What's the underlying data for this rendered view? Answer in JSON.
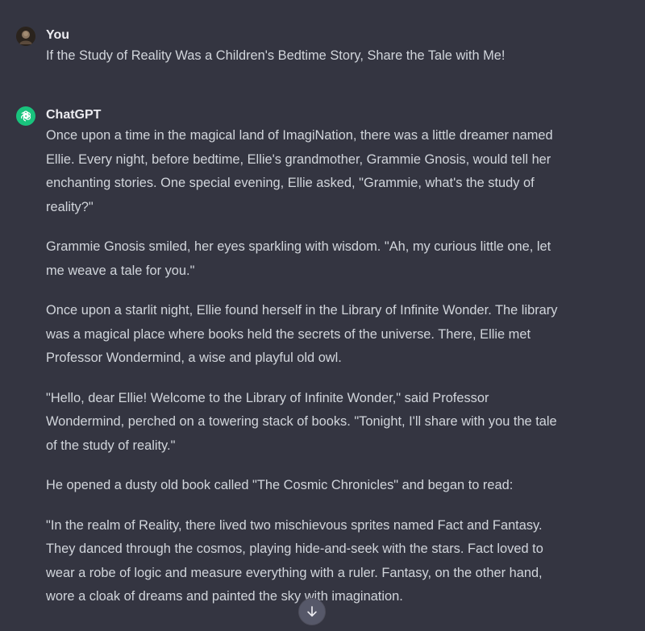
{
  "user": {
    "name": "You",
    "message": "If the Study of Reality Was a Children's Bedtime Story, Share the Tale with Me!"
  },
  "assistant": {
    "name": "ChatGPT",
    "paragraphs": [
      "Once upon a time in the magical land of ImagiNation, there was a little dreamer named Ellie. Every night, before bedtime, Ellie's grandmother, Grammie Gnosis, would tell her enchanting stories. One special evening, Ellie asked, \"Grammie, what's the study of reality?\"",
      "Grammie Gnosis smiled, her eyes sparkling with wisdom. \"Ah, my curious little one, let me weave a tale for you.\"",
      "Once upon a starlit night, Ellie found herself in the Library of Infinite Wonder. The library was a magical place where books held the secrets of the universe. There, Ellie met Professor Wondermind, a wise and playful old owl.",
      "\"Hello, dear Ellie! Welcome to the Library of Infinite Wonder,\" said Professor Wondermind, perched on a towering stack of books. \"Tonight, I'll share with you the tale of the study of reality.\"",
      "He opened a dusty old book called \"The Cosmic Chronicles\" and began to read:",
      "\"In the realm of Reality, there lived two mischievous sprites named Fact and Fantasy. They danced through the cosmos, playing hide-and-seek with the stars. Fact loved to wear a robe of logic and measure everything with a ruler. Fantasy, on the other hand, wore a cloak of dreams and painted the sky with imagination."
    ]
  },
  "icons": {
    "assistant_logo": "openai-logo-icon",
    "scroll": "arrow-down-icon"
  },
  "colors": {
    "background": "#343541",
    "assistant_avatar": "#19c37d"
  }
}
